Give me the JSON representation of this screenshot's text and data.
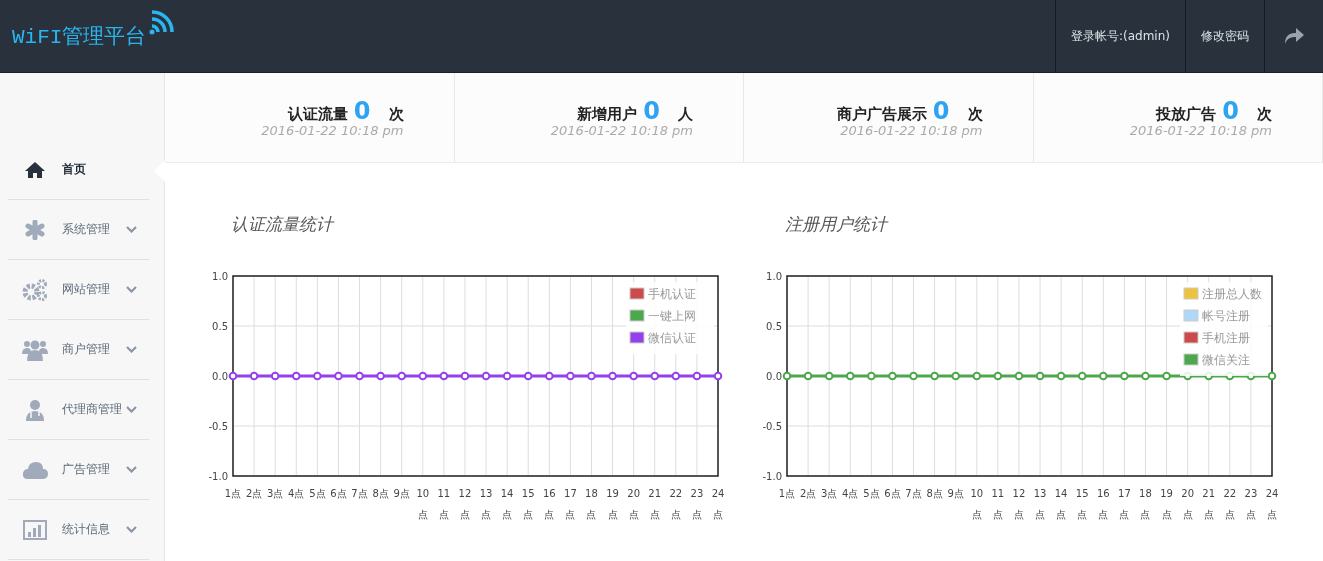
{
  "header": {
    "logo": "WiFI管理平台",
    "account": "登录帐号:(admin)",
    "change_password": "修改密码"
  },
  "stats": [
    {
      "label": "认证流量",
      "value": "0",
      "unit": "次",
      "time": "2016-01-22 10:18 pm"
    },
    {
      "label": "新增用户",
      "value": "0",
      "unit": "人",
      "time": "2016-01-22 10:18 pm"
    },
    {
      "label": "商户广告展示",
      "value": "0",
      "unit": "次",
      "time": "2016-01-22 10:18 pm"
    },
    {
      "label": "投放广告",
      "value": "0",
      "unit": "次",
      "time": "2016-01-22 10:18 pm"
    }
  ],
  "sidebar": {
    "items": [
      {
        "label": "首页",
        "selected": true,
        "expandable": false
      },
      {
        "label": "系统管理",
        "selected": false,
        "expandable": true
      },
      {
        "label": "网站管理",
        "selected": false,
        "expandable": true
      },
      {
        "label": "商户管理",
        "selected": false,
        "expandable": true
      },
      {
        "label": "代理商管理",
        "selected": false,
        "expandable": true
      },
      {
        "label": "广告管理",
        "selected": false,
        "expandable": true
      },
      {
        "label": "统计信息",
        "selected": false,
        "expandable": true
      }
    ]
  },
  "charts": [
    {
      "heading": "认证流量统计",
      "chart_data": {
        "type": "line",
        "grid": true,
        "legend": true,
        "categories": [
          "1点",
          "2点",
          "3点",
          "4点",
          "5点",
          "6点",
          "7点",
          "8点",
          "9点",
          "10点",
          "11点",
          "12点",
          "13点",
          "14点",
          "15点",
          "16点",
          "17点",
          "18点",
          "19点",
          "20点",
          "21点",
          "22点",
          "23点",
          "24点"
        ],
        "series": [
          {
            "name": "手机认证",
            "color": "#cb4b4b",
            "values": [
              null,
              null,
              null,
              null,
              null,
              null,
              null,
              null,
              null,
              null,
              null,
              null,
              null,
              null,
              null,
              null,
              null,
              null,
              null,
              null,
              null,
              null,
              null,
              null
            ]
          },
          {
            "name": "一键上网",
            "color": "#4da74d",
            "values": [
              null,
              null,
              null,
              null,
              null,
              null,
              null,
              null,
              null,
              null,
              null,
              null,
              null,
              null,
              null,
              null,
              null,
              null,
              null,
              null,
              null,
              null,
              null,
              null
            ]
          },
          {
            "name": "微信认证",
            "color": "#9440ed",
            "marker": true,
            "values": [
              0,
              0,
              0,
              0,
              0,
              0,
              0,
              0,
              0,
              0,
              0,
              0,
              0,
              0,
              0,
              0,
              0,
              0,
              0,
              0,
              0,
              0,
              0,
              0
            ]
          }
        ],
        "ylim": [
          -1,
          1
        ],
        "yticks": [
          {
            "value": -1,
            "label": "-1.0"
          },
          {
            "value": -0.5,
            "label": "-0.5"
          },
          {
            "value": 0,
            "label": "0.0"
          },
          {
            "value": 0.5,
            "label": "0.5"
          },
          {
            "value": 1,
            "label": "1.0"
          }
        ]
      }
    },
    {
      "heading": "注册用户统计",
      "chart_data": {
        "type": "line",
        "grid": true,
        "legend": true,
        "categories": [
          "1点",
          "2点",
          "3点",
          "4点",
          "5点",
          "6点",
          "7点",
          "8点",
          "9点",
          "10点",
          "11点",
          "12点",
          "13点",
          "14点",
          "15点",
          "16点",
          "17点",
          "18点",
          "19点",
          "20点",
          "21点",
          "22点",
          "23点",
          "24点"
        ],
        "series": [
          {
            "name": "注册总人数",
            "color": "#edc240",
            "values": [
              null,
              null,
              null,
              null,
              null,
              null,
              null,
              null,
              null,
              null,
              null,
              null,
              null,
              null,
              null,
              null,
              null,
              null,
              null,
              null,
              null,
              null,
              null,
              null
            ]
          },
          {
            "name": "帐号注册",
            "color": "#afd8f8",
            "values": [
              null,
              null,
              null,
              null,
              null,
              null,
              null,
              null,
              null,
              null,
              null,
              null,
              null,
              null,
              null,
              null,
              null,
              null,
              null,
              null,
              null,
              null,
              null,
              null
            ]
          },
          {
            "name": "手机注册",
            "color": "#cb4b4b",
            "values": [
              null,
              null,
              null,
              null,
              null,
              null,
              null,
              null,
              null,
              null,
              null,
              null,
              null,
              null,
              null,
              null,
              null,
              null,
              null,
              null,
              null,
              null,
              null,
              null
            ]
          },
          {
            "name": "微信关注",
            "color": "#4da74d",
            "marker": true,
            "values": [
              0,
              0,
              0,
              0,
              0,
              0,
              0,
              0,
              0,
              0,
              0,
              0,
              0,
              0,
              0,
              0,
              0,
              0,
              0,
              0,
              0,
              0,
              0,
              0
            ]
          }
        ],
        "ylim": [
          -1,
          1
        ],
        "yticks": [
          {
            "value": -1,
            "label": "-1.0"
          },
          {
            "value": -0.5,
            "label": "-0.5"
          },
          {
            "value": 0,
            "label": "0.0"
          },
          {
            "value": 0.5,
            "label": "0.5"
          },
          {
            "value": 1,
            "label": "1.0"
          }
        ]
      }
    }
  ]
}
